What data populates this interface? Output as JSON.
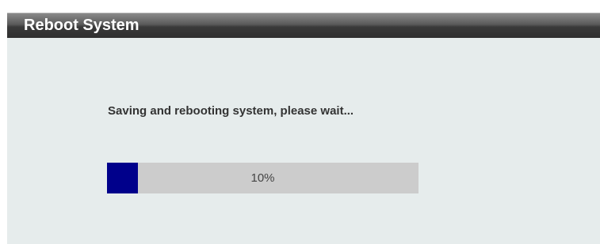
{
  "header": {
    "title": "Reboot System"
  },
  "main": {
    "message": "Saving and rebooting system, please wait...",
    "progress": {
      "value_percent": 10,
      "label": "10%"
    }
  },
  "colors": {
    "panel_background": "#e6ecec",
    "progress_fill": "#00008b",
    "progress_track": "#cccccc",
    "header_text": "#ffffff"
  }
}
